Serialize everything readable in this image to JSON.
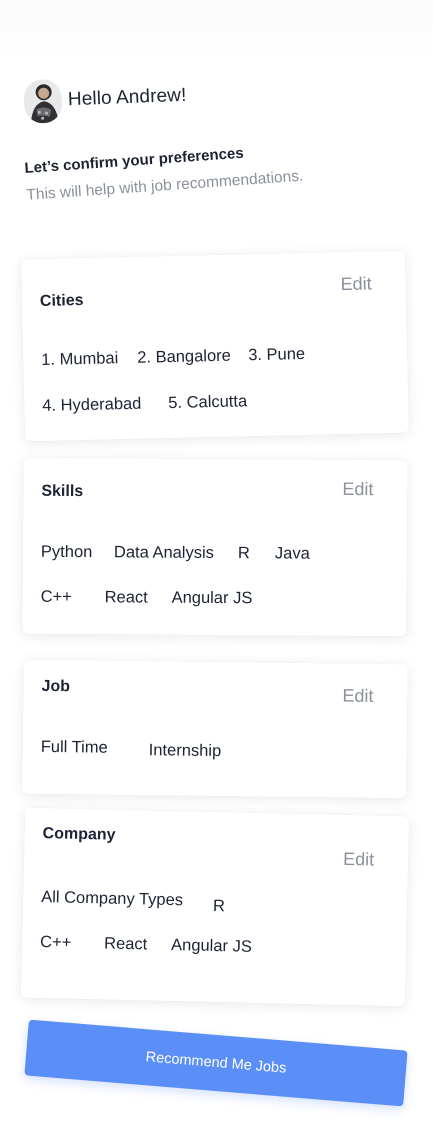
{
  "header": {
    "greeting": "Hello Andrew!",
    "avatar_icon": "user-avatar-icon"
  },
  "intro": {
    "title": "Let’s confirm your preferences",
    "subtitle": "This will help with job recommendations."
  },
  "cards": {
    "cities": {
      "title": "Cities",
      "edit_label": "Edit",
      "items": [
        "1. Mumbai",
        "2. Bangalore",
        "3. Pune",
        "4. Hyderabad",
        "5. Calcutta"
      ]
    },
    "skills": {
      "title": "Skills",
      "edit_label": "Edit",
      "items": [
        "Python",
        "Data Analysis",
        "R",
        "Java",
        "C++",
        "React",
        "Angular JS"
      ]
    },
    "job": {
      "title": "Job",
      "edit_label": "Edit",
      "items": [
        "Full Time",
        "Internship"
      ]
    },
    "company": {
      "title": "Company",
      "edit_label": "Edit",
      "items": [
        "All Company Types",
        "R",
        "C++",
        "React",
        "Angular JS"
      ]
    }
  },
  "cta": {
    "label": "Recommend Me Jobs"
  },
  "colors": {
    "accent": "#5b8ff7",
    "text": "#1c2333",
    "muted": "#8a909c"
  }
}
